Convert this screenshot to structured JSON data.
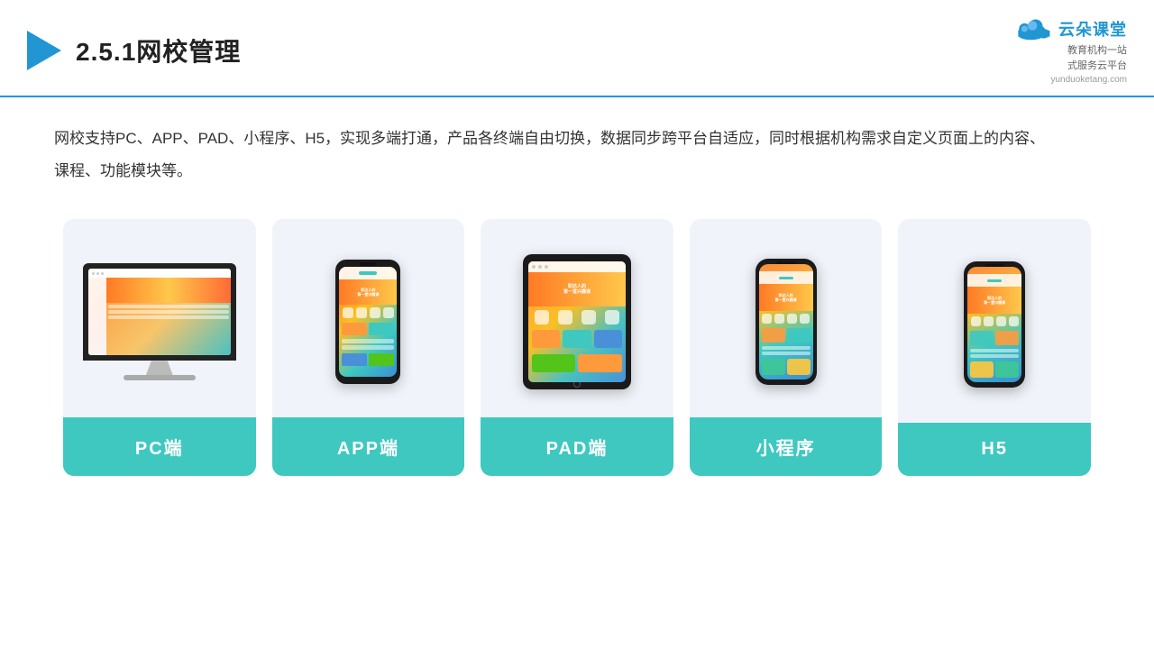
{
  "header": {
    "title": "2.5.1网校管理",
    "brand": {
      "name": "云朵课堂",
      "url": "yunduoketang.com",
      "tagline": "教育机构一站\n式服务云平台"
    }
  },
  "description": "网校支持PC、APP、PAD、小程序、H5，实现多端打通，产品各终端自由切换，数据同步跨平台自适应，同时根据机构需求自定义页面上的内容、课程、功能模块等。",
  "cards": [
    {
      "id": "pc",
      "label": "PC端"
    },
    {
      "id": "app",
      "label": "APP端"
    },
    {
      "id": "pad",
      "label": "PAD端"
    },
    {
      "id": "miniprogram",
      "label": "小程序"
    },
    {
      "id": "h5",
      "label": "H5"
    }
  ],
  "colors": {
    "accent": "#2196d3",
    "teal": "#3ec8c0",
    "card_bg": "#eef2f9"
  }
}
